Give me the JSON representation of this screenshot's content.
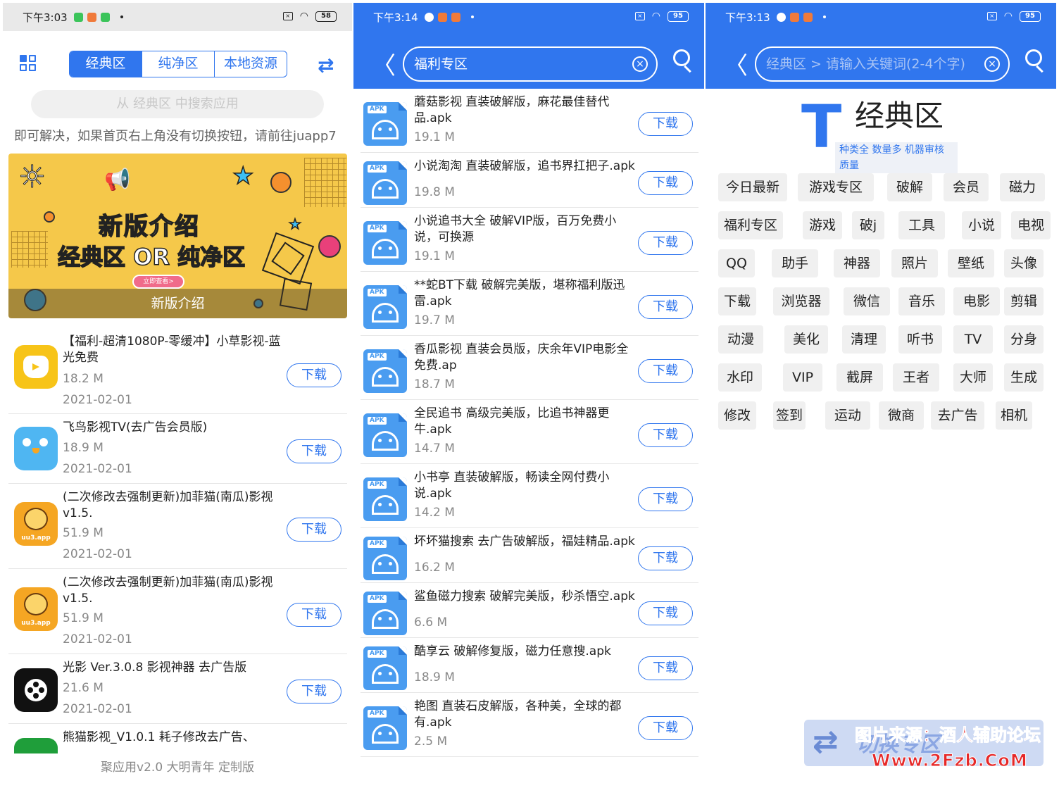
{
  "colors": {
    "accent": "#3076ee",
    "download_border": "#3076ee",
    "watermark": "#e62828"
  },
  "panel1": {
    "status": {
      "time": "下午3:03",
      "battery": "58"
    },
    "tabs": [
      "经典区",
      "纯净区",
      "本地资源"
    ],
    "search_placeholder": "从 经典区 中搜索应用",
    "marquee": "即可解决，如果首页右上角没有切换按钮，请前往juapp7",
    "banner": {
      "title": "新版介绍",
      "line_a": "经典区",
      "line_or": "OR",
      "line_b": "纯净区",
      "pill": "立即查看>",
      "caption": "新版介绍"
    },
    "apps": [
      {
        "name": "【福利-超清1080P-零缓冲】小草影视-蓝光免费",
        "size": "18.2 M",
        "date": "2021-02-01",
        "btn": "下载"
      },
      {
        "name": "飞鸟影视TV(去广告会员版)",
        "size": "18.9 M",
        "date": "2021-02-01",
        "btn": "下载"
      },
      {
        "name": "(二次修改去强制更新)加菲猫(南瓜)影视v1.5.",
        "size": "51.9 M",
        "date": "2021-02-01",
        "btn": "下载",
        "icon_text": "uu3.app"
      },
      {
        "name": "(二次修改去强制更新)加菲猫(南瓜)影视v1.5.",
        "size": "51.9 M",
        "date": "2021-02-01",
        "btn": "下载",
        "icon_text": "uu3.app"
      },
      {
        "name": "光影 Ver.3.0.8 影视神器 去广告版",
        "size": "21.6 M",
        "date": "2021-02-01",
        "btn": "下载"
      },
      {
        "name": "熊猫影视_V1.0.1 耗子修改去广告、",
        "size": "",
        "date": "",
        "btn": ""
      }
    ],
    "footer": "聚应用v2.0 大明青年 定制版"
  },
  "panel2": {
    "status": {
      "time": "下午3:14",
      "battery": "95"
    },
    "search_value": "福利专区",
    "apk_label": "APK",
    "items": [
      {
        "name": "蘑菇影视 直装破解版，麻花最佳替代品.apk",
        "size": "19.1 M",
        "btn": "下载"
      },
      {
        "name": "小说淘淘 直装破解版，追书界扛把子.apk",
        "size": "19.8 M",
        "btn": "下载"
      },
      {
        "name": "小说追书大全 破解VIP版，百万免费小说，可换源",
        "size": "19.1 M",
        "btn": "下载"
      },
      {
        "name": "**蛇BT下载 破解完美版，堪称福利版迅雷.apk",
        "size": "19.7 M",
        "btn": "下载"
      },
      {
        "name": "香瓜影视 直装会员版，庆余年VIP电影全免费.ap",
        "size": "18.7 M",
        "btn": "下载"
      },
      {
        "name": "全民追书 高级完美版，比追书神器更牛.apk",
        "size": "14.7 M",
        "btn": "下载"
      },
      {
        "name": "小书亭 直装破解版，畅读全网付费小说.apk",
        "size": "14.2 M",
        "btn": "下载"
      },
      {
        "name": "坏坏猫搜索 去广告破解版，福娃精品.apk",
        "size": "16.2 M",
        "btn": "下载"
      },
      {
        "name": "鲨鱼磁力搜索 破解完美版，秒杀悟空.apk",
        "size": "6.6 M",
        "btn": "下载"
      },
      {
        "name": "酷享云 破解修复版，磁力任意搜.apk",
        "size": "18.9 M",
        "btn": "下载"
      },
      {
        "name": "艳图 直装石皮解版，各种美，全球的都有.apk",
        "size": "2.5 M",
        "btn": "下载"
      }
    ]
  },
  "panel3": {
    "status": {
      "time": "下午3:13",
      "battery": "95"
    },
    "search_placeholder": "经典区 > 请输入关键词(2-4个字)",
    "logo": {
      "letter": "T",
      "name": "经典区",
      "sub": "种类全 数量多 机器审核质量"
    },
    "tags": [
      [
        "今日最新",
        "游戏专区",
        "破解",
        "会员",
        "磁力"
      ],
      [
        "福利专区",
        "游戏",
        "破j",
        "工具",
        "小说",
        "电视"
      ],
      [
        "QQ",
        "助手",
        "神器",
        "照片",
        "壁纸",
        "头像"
      ],
      [
        "下载",
        "浏览器",
        "微信",
        "音乐",
        "电影",
        "剪辑"
      ],
      [
        "动漫",
        "美化",
        "清理",
        "听书",
        "TV",
        "分身"
      ],
      [
        "水印",
        "VIP",
        "截屏",
        "王者",
        "大师",
        "生成"
      ],
      [
        "修改",
        "签到",
        "运动",
        "微商",
        "去广告",
        "相机"
      ]
    ],
    "badge_text": "切换专区",
    "watermark_1": "图片来源：酒人辅助论坛",
    "watermark_2": "Www.2Fzb.CoM"
  }
}
